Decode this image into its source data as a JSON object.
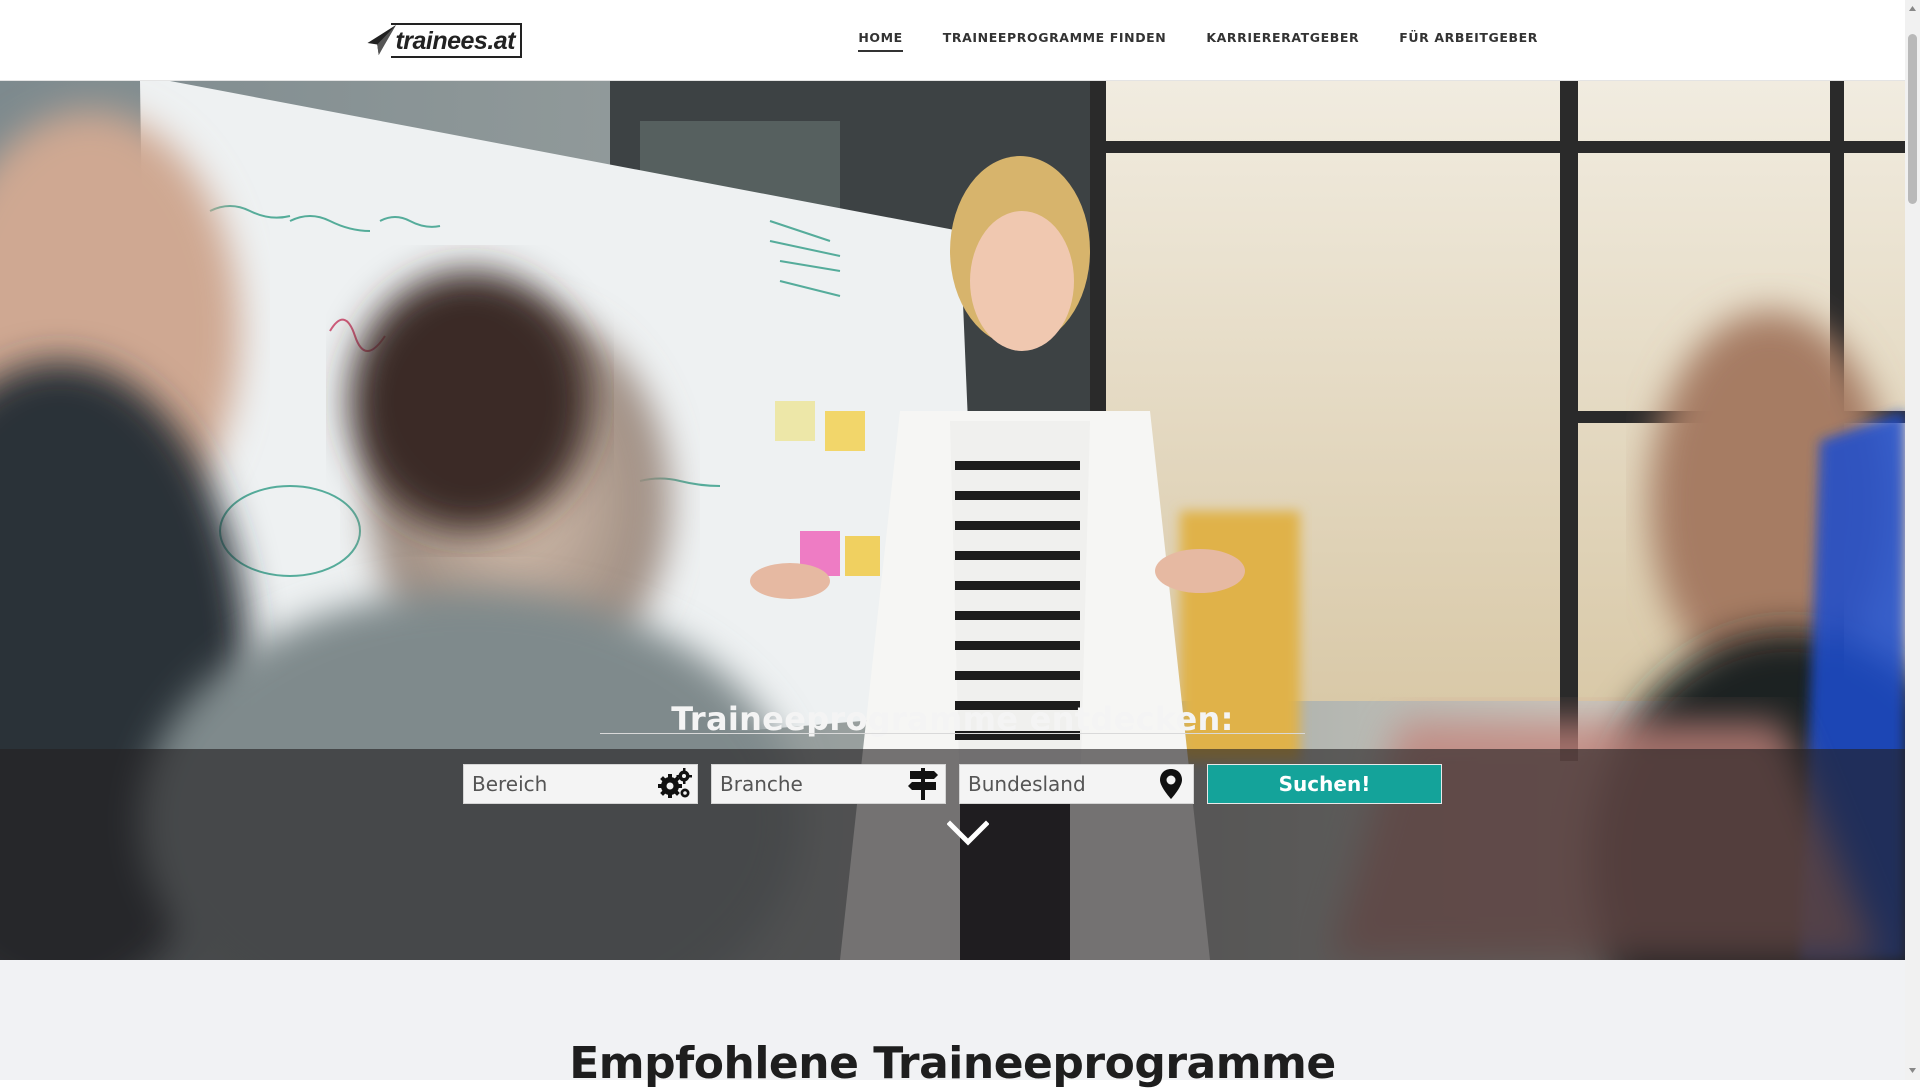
{
  "header": {
    "logo_text": "trainees.at",
    "nav": [
      {
        "label": "HOME",
        "active": true
      },
      {
        "label": "TRAINEEPROGRAMME FINDEN",
        "active": false
      },
      {
        "label": "KARRIERERATGEBER",
        "active": false
      },
      {
        "label": "FÜR ARBEITGEBER",
        "active": false
      }
    ]
  },
  "hero": {
    "title": "Traineeprogramme entdecken:",
    "fields": [
      {
        "placeholder": "Bereich",
        "icon": "gears-icon"
      },
      {
        "placeholder": "Branche",
        "icon": "signpost-icon"
      },
      {
        "placeholder": "Bundesland",
        "icon": "map-pin-icon"
      }
    ],
    "search_label": "Suchen!",
    "scroll_icon": "chevron-down-icon"
  },
  "section": {
    "title": "Empfohlene Traineeprogramme"
  },
  "colors": {
    "accent": "#14a39a",
    "band": "#232122",
    "text_dark": "#1e1e1e"
  }
}
